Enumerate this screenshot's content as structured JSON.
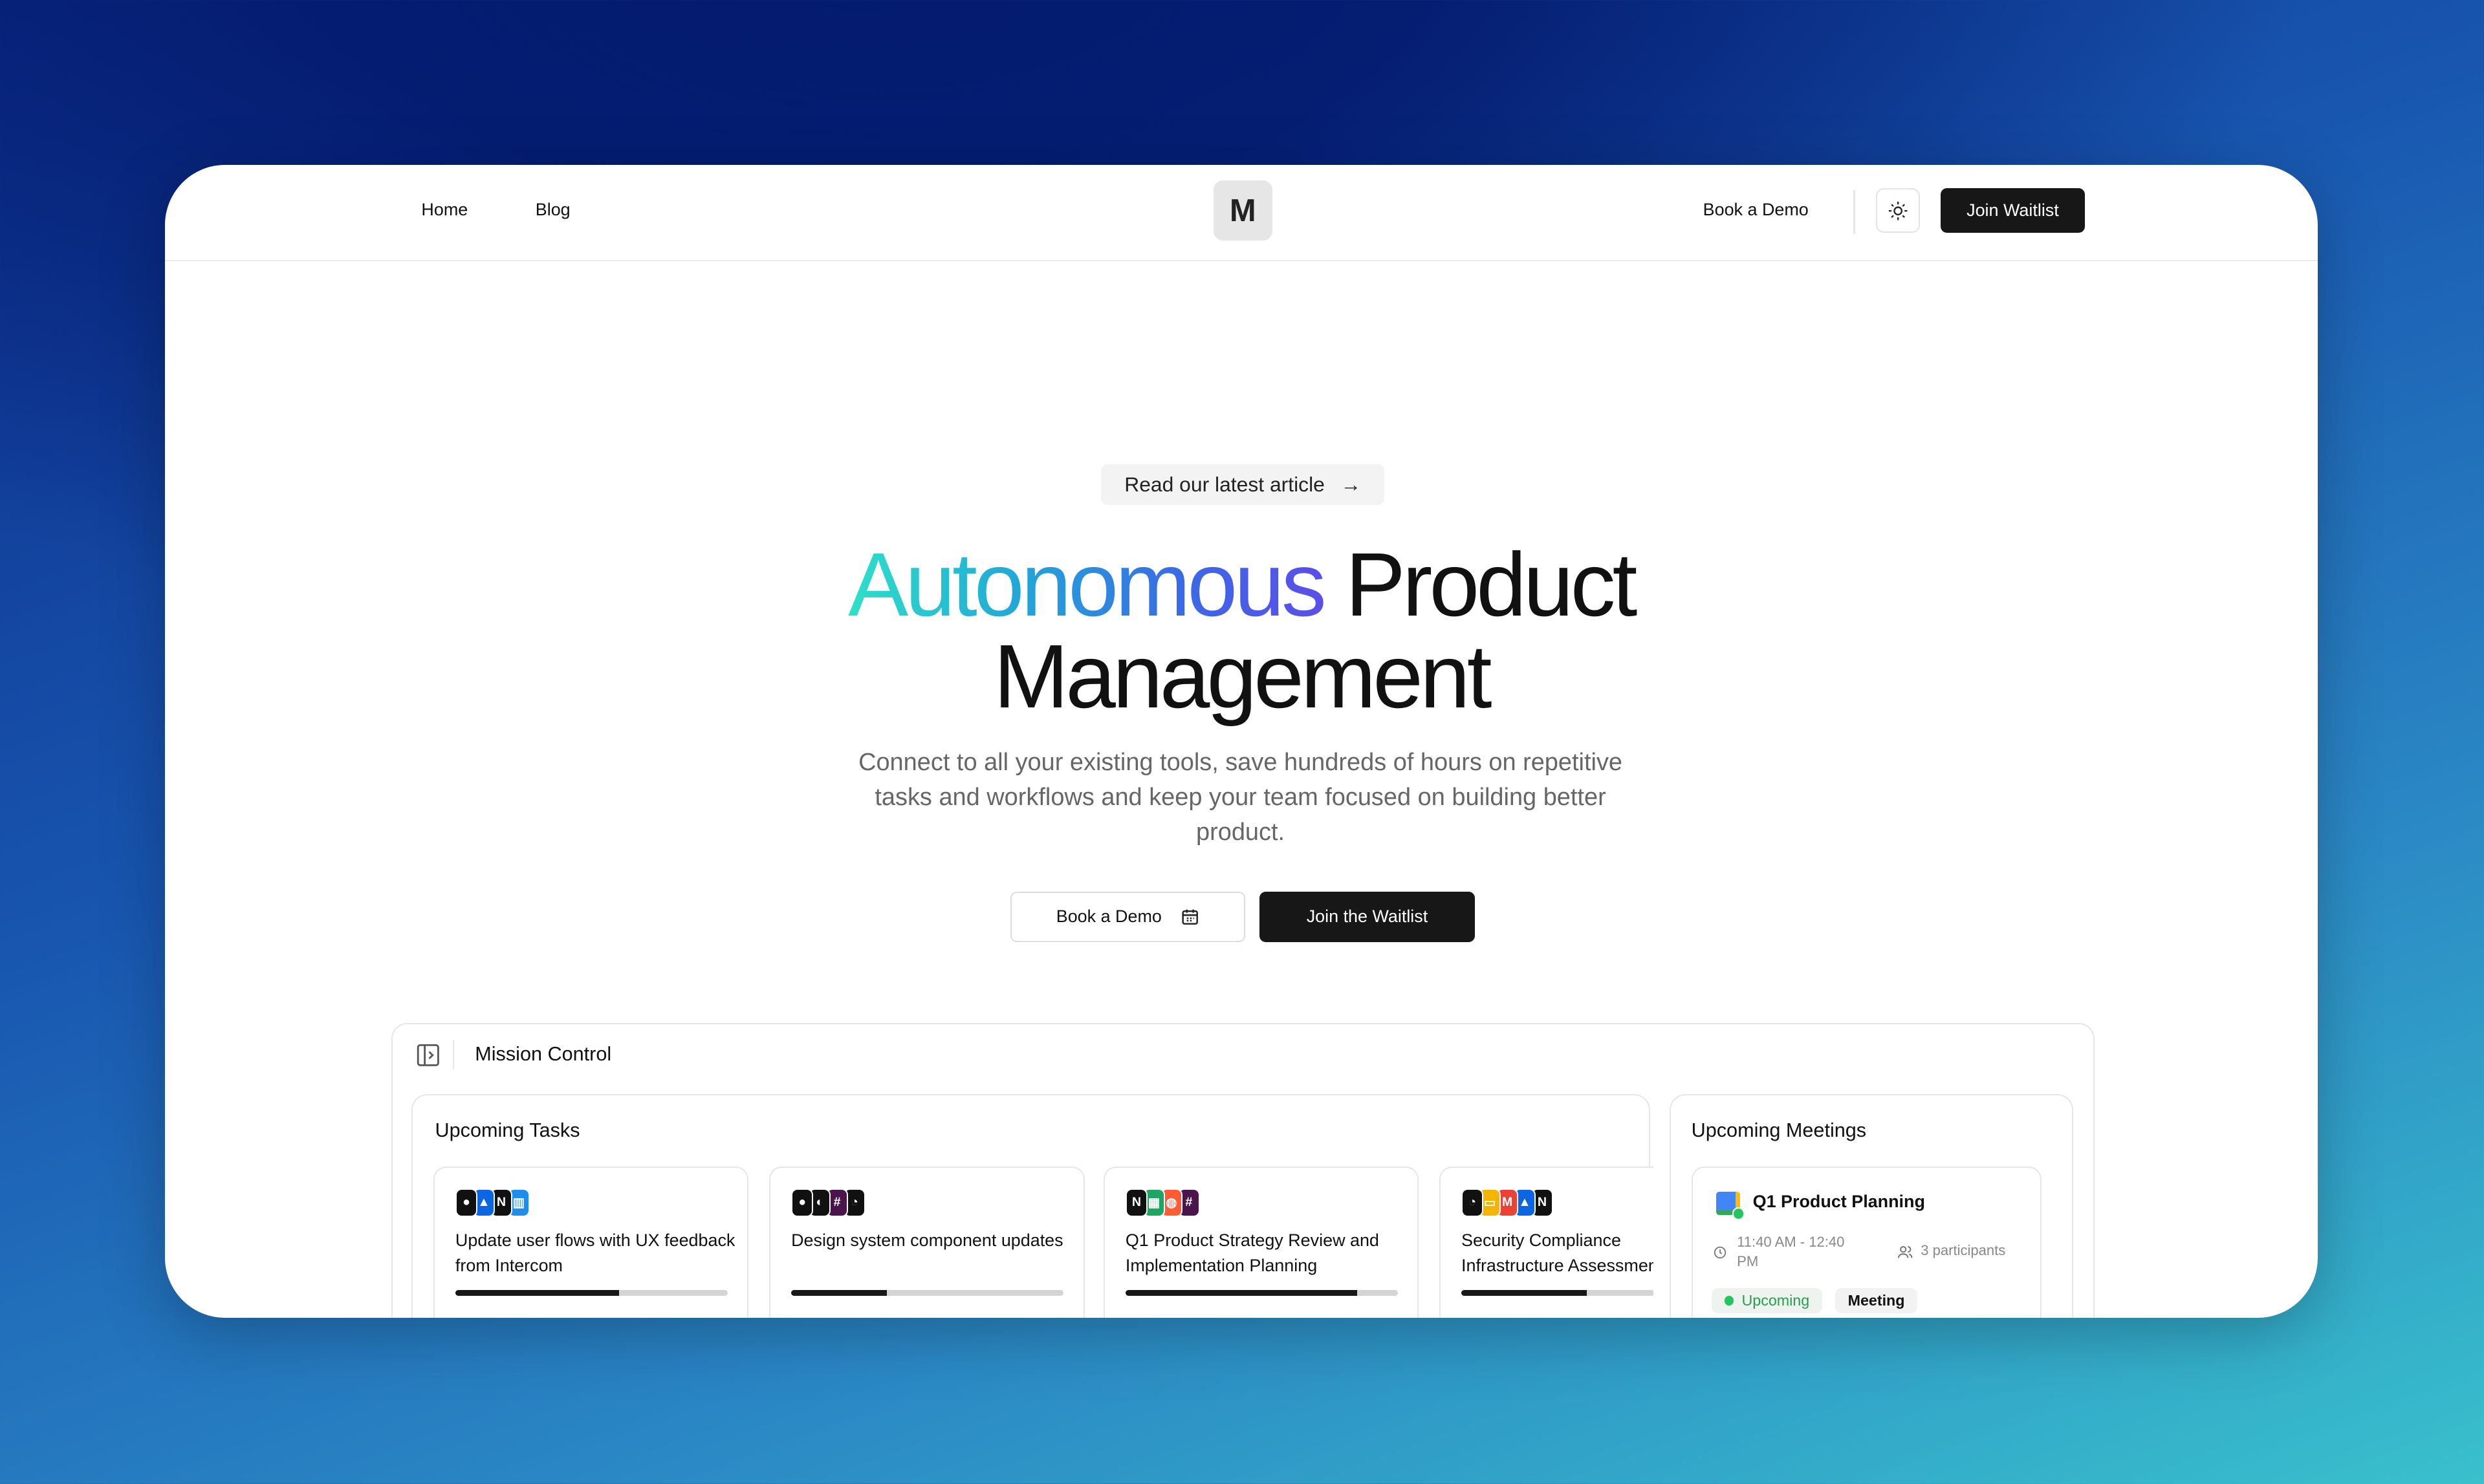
{
  "nav": {
    "links": [
      "Home",
      "Blog"
    ],
    "logo": "M",
    "book_demo": "Book a Demo",
    "theme_icon": "sun-icon",
    "join": "Join Waitlist"
  },
  "hero": {
    "pill": "Read our latest article",
    "pill_arrow": "→",
    "title_gradient": "Autonomous",
    "title_rest": "Product",
    "title_line2": "Management",
    "subtitle": "Connect to all your existing tools, save hundreds of hours on repetitive tasks and workflows and keep your team focused on building better product.",
    "book_demo": "Book a Demo",
    "join": "Join the Waitlist"
  },
  "colors": {
    "gradient_start": "#2ee0c8",
    "gradient_end": "#5b4ee8",
    "primary": "#171717"
  },
  "mission": {
    "title": "Mission Control",
    "tasks": {
      "title": "Upcoming Tasks",
      "items": [
        {
          "text": "Update user flows with UX feedback from Intercom",
          "progress": 60,
          "icons": [
            "github",
            "jira",
            "notion",
            "intercom"
          ]
        },
        {
          "text": "Design system component updates",
          "progress": 35,
          "icons": [
            "github",
            "discord",
            "slack",
            "linear"
          ]
        },
        {
          "text": "Q1 Product Strategy Review and Implementation Planning",
          "progress": 85,
          "icons": [
            "notion",
            "google-sheets",
            "hubspot",
            "slack"
          ]
        },
        {
          "text": "Security Compliance Infrastructure Assessment",
          "progress": 65,
          "icons": [
            "linear",
            "google-slides",
            "gmail",
            "jira",
            "notion"
          ]
        }
      ]
    },
    "meetings": {
      "title": "Upcoming Meetings",
      "items": [
        {
          "title": "Q1 Product Planning",
          "time": "11:40 AM - 12:40 PM",
          "participants": "3 participants",
          "status": "Upcoming",
          "type": "Meeting",
          "icon": "google-calendar"
        }
      ]
    }
  }
}
